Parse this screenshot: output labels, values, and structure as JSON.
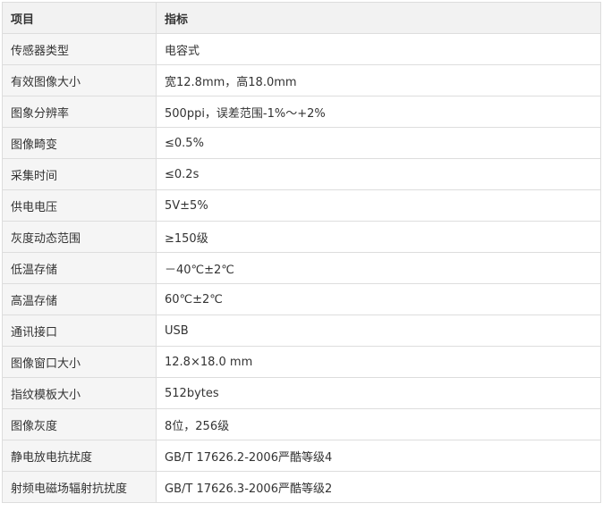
{
  "table": {
    "headers": [
      "项目",
      "指标"
    ],
    "rows": [
      [
        "传感器类型",
        "电容式"
      ],
      [
        "有效图像大小",
        "宽12.8mm，高18.0mm"
      ],
      [
        "图象分辨率",
        "500ppi，误差范围-1%～+2%"
      ],
      [
        "图像畸变",
        "≤0.5%"
      ],
      [
        "采集时间",
        "≤0.2s"
      ],
      [
        "供电电压",
        "5V±5%"
      ],
      [
        "灰度动态范围",
        "≥150级"
      ],
      [
        "低温存储",
        "－40℃±2℃"
      ],
      [
        "高温存储",
        "60℃±2℃"
      ],
      [
        "通讯接口",
        "USB"
      ],
      [
        "图像窗口大小",
        "12.8×18.0 mm"
      ],
      [
        "指纹模板大小",
        "512bytes"
      ],
      [
        "图像灰度",
        "8位，256级"
      ],
      [
        "静电放电抗扰度",
        "GB/T 17626.2-2006严酷等级4"
      ],
      [
        "射频电磁场辐射抗扰度",
        "GB/T 17626.3-2006严酷等级2"
      ]
    ]
  }
}
